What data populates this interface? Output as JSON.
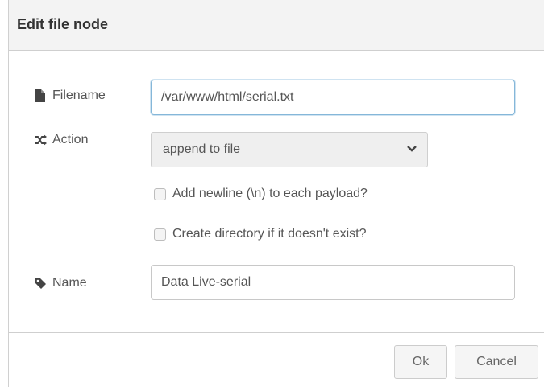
{
  "dialog": {
    "title": "Edit file node"
  },
  "fields": {
    "filename": {
      "label": "Filename",
      "value": "/var/www/html/serial.txt",
      "icon": "file-icon"
    },
    "action": {
      "label": "Action",
      "selected": "append to file",
      "icon": "shuffle-icon"
    },
    "add_newline": {
      "label": "Add newline (\\n) to each payload?",
      "checked": false
    },
    "create_dir": {
      "label": "Create directory if it doesn't exist?",
      "checked": false
    },
    "name": {
      "label": "Name",
      "value": "Data Live-serial",
      "icon": "tag-icon"
    }
  },
  "buttons": {
    "ok_label": "Ok",
    "cancel_label": "Cancel"
  },
  "colors": {
    "focus_border": "#85b7d9",
    "titlebar_bg": "#f3f3f3"
  }
}
